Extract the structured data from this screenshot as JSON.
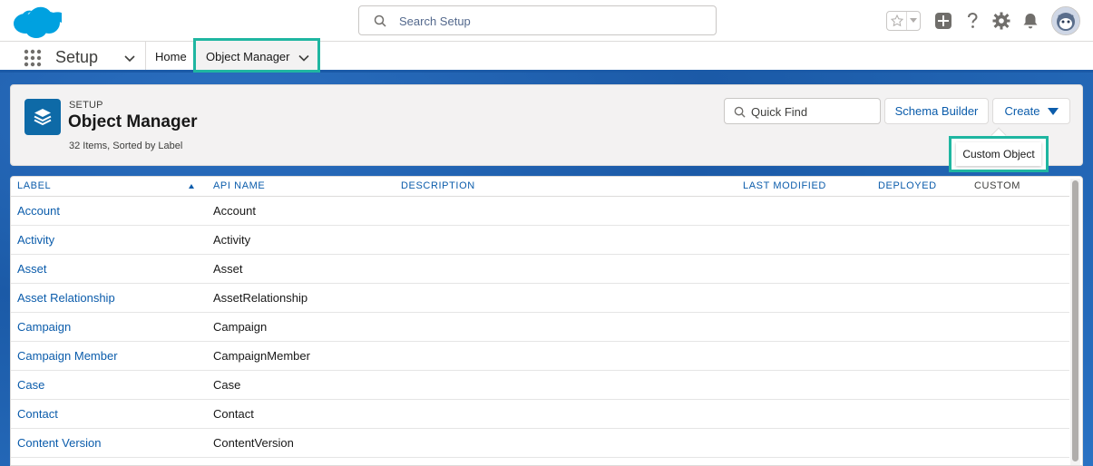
{
  "search": {
    "placeholder": "Search Setup"
  },
  "nav": {
    "app_name": "Setup",
    "home_label": "Home",
    "active_tab_label": "Object Manager"
  },
  "header": {
    "eyebrow": "SETUP",
    "title": "Object Manager",
    "meta": "32 Items, Sorted by Label",
    "quick_find_placeholder": "Quick Find",
    "schema_builder_label": "Schema Builder",
    "create_label": "Create",
    "dropdown_item": "Custom Object"
  },
  "table": {
    "columns": [
      "LABEL",
      "API NAME",
      "DESCRIPTION",
      "LAST MODIFIED",
      "DEPLOYED",
      "CUSTOM"
    ],
    "rows": [
      {
        "label": "Account",
        "api": "Account"
      },
      {
        "label": "Activity",
        "api": "Activity"
      },
      {
        "label": "Asset",
        "api": "Asset"
      },
      {
        "label": "Asset Relationship",
        "api": "AssetRelationship"
      },
      {
        "label": "Campaign",
        "api": "Campaign"
      },
      {
        "label": "Campaign Member",
        "api": "CampaignMember"
      },
      {
        "label": "Case",
        "api": "Case"
      },
      {
        "label": "Contact",
        "api": "Contact"
      },
      {
        "label": "Content Version",
        "api": "ContentVersion"
      }
    ]
  },
  "colors": {
    "brand_blue": "#1b5aa7",
    "link": "#0b5cab",
    "highlight": "#1fb6a1",
    "object_icon": "#0e6aa7",
    "salesforce_cloud": "#00a1e0"
  }
}
